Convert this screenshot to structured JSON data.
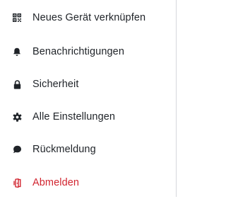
{
  "menu": {
    "items": [
      {
        "label": "Neues Gerät verknüpfen",
        "icon": "qr-code-icon"
      },
      {
        "label": "Benachrichtigungen",
        "icon": "bell-icon"
      },
      {
        "label": "Sicherheit",
        "icon": "lock-icon"
      },
      {
        "label": "Alle Einstellungen",
        "icon": "gear-icon"
      },
      {
        "label": "Rückmeldung",
        "icon": "speech-bubble-icon"
      },
      {
        "label": "Abmelden",
        "icon": "sign-out-icon"
      }
    ]
  },
  "colors": {
    "text": "#1f2328",
    "icon": "#1f2328",
    "danger": "#d1242f",
    "divider": "#d6d8dc"
  }
}
